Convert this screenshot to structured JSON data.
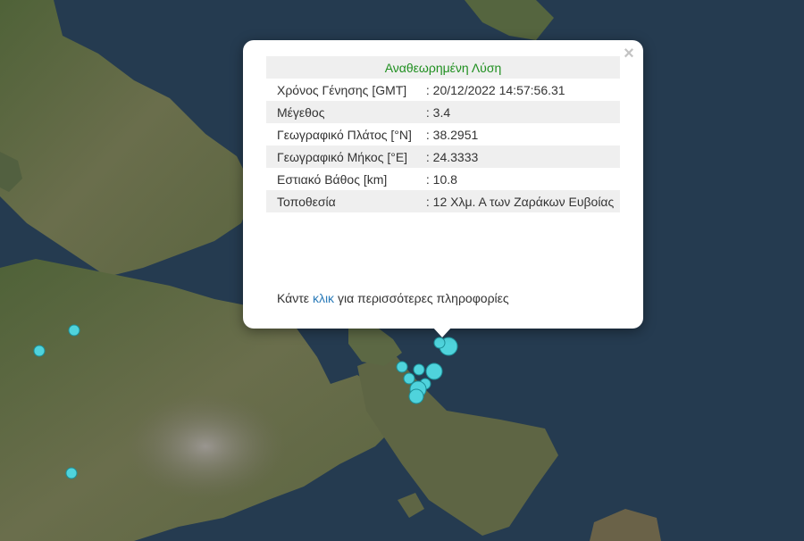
{
  "popup": {
    "title": "Αναθεωρημένη Λύση",
    "close_symbol": "×",
    "rows": [
      {
        "label": "Χρόνος Γένησης [GMT]",
        "value": ": 20/12/2022 14:57:56.31"
      },
      {
        "label": "Μέγεθος",
        "value": ": 3.4"
      },
      {
        "label": "Γεωγραφικό Πλάτος [°N]",
        "value": ": 38.2951"
      },
      {
        "label": "Γεωγραφικό Μήκος [°E]",
        "value": ": 24.3333"
      },
      {
        "label": "Εστιακό Βάθος [km]",
        "value": ": 10.8"
      },
      {
        "label": "Τοποθεσία",
        "value": ": 12 Χλμ. Α των Ζαράκων Ευβοίας"
      }
    ],
    "more_prefix": "Κάντε",
    "more_link": "κλικ",
    "more_suffix": "για περισσότερες πληροφορίες"
  },
  "map": {
    "sea_color": "#243a4e",
    "land_color": "#5a6a44",
    "marker_color": "#4fd3dc",
    "marker_border": "#1c8f98"
  }
}
